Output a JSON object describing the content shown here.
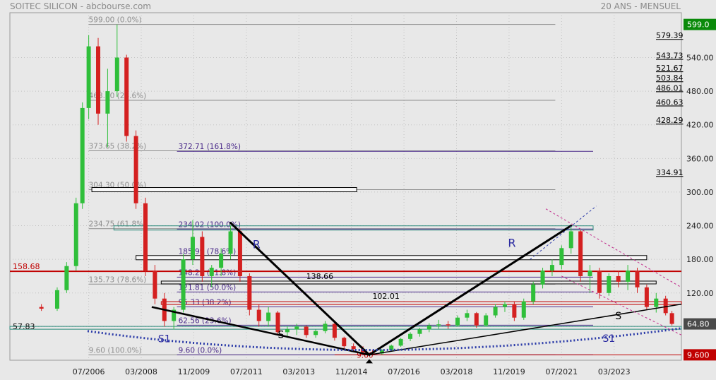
{
  "header": {
    "title": "SOITEC SILICON - abcbourse.com",
    "period": "20 ANS - MENSUEL"
  },
  "chart_data": {
    "type": "candlestick",
    "instrument": "SOITEC SILICON",
    "timeframe": "20 ANS - MENSUEL",
    "ylim": [
      0,
      620
    ],
    "x_range": [
      2004.0,
      2025.3
    ],
    "x_ticks": [
      "07/2006",
      "03/2008",
      "11/2009",
      "07/2011",
      "03/2013",
      "11/2014",
      "07/2016",
      "03/2018",
      "11/2019",
      "07/2021",
      "03/2023"
    ],
    "y_ticks": [
      60,
      120,
      180,
      240,
      300,
      360,
      420,
      480,
      540
    ],
    "y_tick_labels": [
      "",
      "120.00",
      "180.00",
      "240.00",
      "300.00",
      "360.00",
      "420.00",
      "480.00",
      "540.00"
    ],
    "right_labels": [
      "579.39",
      "543.73",
      "521.67",
      "503.84",
      "486.01",
      "460.63",
      "428.29",
      "334.91"
    ],
    "right_label_values": [
      579.39,
      543.73,
      521.67,
      503.84,
      486.01,
      460.63,
      428.29,
      334.91
    ],
    "price_badges": [
      {
        "label": "599.0",
        "value": 599.0,
        "color": "#0a8a0a"
      },
      {
        "label": "64.80",
        "value": 64.8,
        "color": "#4a4a4a"
      },
      {
        "label": "9.600",
        "value": 9.6,
        "color": "#c00000"
      }
    ],
    "fib_retracement_1": [
      {
        "label": "599.00  (0.0%)",
        "value": 599.0
      },
      {
        "label": "463.80  (23.6%)",
        "value": 463.8
      },
      {
        "label": "373.65  (38.2%)",
        "value": 373.65
      },
      {
        "label": "304.30  (50.0%)",
        "value": 304.3
      },
      {
        "label": "234.75  (61.8%)",
        "value": 234.75
      },
      {
        "label": "135.73  (78.6%)",
        "value": 135.73
      },
      {
        "label": "9.60  (100.0%)",
        "value": 9.6
      }
    ],
    "fib_retracement_2": [
      {
        "label": "372.71  (161.8%)",
        "value": 372.71
      },
      {
        "label": "234.02  (100.0%)",
        "value": 234.02
      },
      {
        "label": "185.99  (78.6%)",
        "value": 185.99
      },
      {
        "label": "148.29  (61.8%)",
        "value": 148.29
      },
      {
        "label": "121.81  (50.0%)",
        "value": 121.81
      },
      {
        "label": "95.33  (38.2%)",
        "value": 95.33
      },
      {
        "label": "62.56  (23.6%)",
        "value": 62.56
      },
      {
        "label": "9.60  (0.0%)",
        "value": 9.6
      }
    ],
    "horizontal_levels": [
      {
        "label": "158.68",
        "value": 158.68,
        "color": "#c00000"
      },
      {
        "label": "138.66",
        "value": 138.66,
        "color": "#000000"
      },
      {
        "label": "102.01",
        "value": 102.01,
        "color": "#000000"
      },
      {
        "label": "57.83",
        "value": 57.83,
        "color": "#2a8a7a"
      },
      {
        "label": "9.60",
        "value": 9.6,
        "color": "#c00000"
      }
    ],
    "annotations": [
      "R",
      "R",
      "S",
      "S",
      "S1",
      "S1"
    ],
    "candles": [
      {
        "t": 2005.0,
        "o": 95,
        "h": 100,
        "l": 88,
        "c": 92
      },
      {
        "t": 2005.5,
        "o": 92,
        "h": 130,
        "l": 88,
        "c": 125
      },
      {
        "t": 2005.8,
        "o": 125,
        "h": 175,
        "l": 120,
        "c": 168
      },
      {
        "t": 2006.1,
        "o": 168,
        "h": 290,
        "l": 160,
        "c": 280
      },
      {
        "t": 2006.3,
        "o": 280,
        "h": 460,
        "l": 270,
        "c": 450
      },
      {
        "t": 2006.5,
        "o": 450,
        "h": 580,
        "l": 430,
        "c": 560
      },
      {
        "t": 2006.8,
        "o": 560,
        "h": 575,
        "l": 420,
        "c": 440
      },
      {
        "t": 2007.1,
        "o": 440,
        "h": 520,
        "l": 380,
        "c": 480
      },
      {
        "t": 2007.4,
        "o": 480,
        "h": 599,
        "l": 470,
        "c": 540
      },
      {
        "t": 2007.7,
        "o": 540,
        "h": 545,
        "l": 390,
        "c": 400
      },
      {
        "t": 2008.0,
        "o": 400,
        "h": 410,
        "l": 270,
        "c": 280
      },
      {
        "t": 2008.3,
        "o": 280,
        "h": 290,
        "l": 150,
        "c": 160
      },
      {
        "t": 2008.6,
        "o": 160,
        "h": 170,
        "l": 100,
        "c": 110
      },
      {
        "t": 2008.9,
        "o": 110,
        "h": 120,
        "l": 60,
        "c": 70
      },
      {
        "t": 2009.2,
        "o": 70,
        "h": 95,
        "l": 55,
        "c": 90
      },
      {
        "t": 2009.5,
        "o": 90,
        "h": 190,
        "l": 85,
        "c": 180
      },
      {
        "t": 2009.8,
        "o": 180,
        "h": 250,
        "l": 170,
        "c": 220
      },
      {
        "t": 2010.1,
        "o": 220,
        "h": 230,
        "l": 140,
        "c": 150
      },
      {
        "t": 2010.4,
        "o": 150,
        "h": 170,
        "l": 130,
        "c": 165
      },
      {
        "t": 2010.7,
        "o": 165,
        "h": 200,
        "l": 150,
        "c": 190
      },
      {
        "t": 2011.0,
        "o": 190,
        "h": 240,
        "l": 180,
        "c": 230
      },
      {
        "t": 2011.3,
        "o": 230,
        "h": 235,
        "l": 140,
        "c": 150
      },
      {
        "t": 2011.6,
        "o": 150,
        "h": 155,
        "l": 80,
        "c": 90
      },
      {
        "t": 2011.9,
        "o": 90,
        "h": 100,
        "l": 60,
        "c": 70
      },
      {
        "t": 2012.2,
        "o": 70,
        "h": 95,
        "l": 60,
        "c": 85
      },
      {
        "t": 2012.5,
        "o": 85,
        "h": 88,
        "l": 45,
        "c": 50
      },
      {
        "t": 2012.8,
        "o": 50,
        "h": 60,
        "l": 40,
        "c": 55
      },
      {
        "t": 2013.1,
        "o": 55,
        "h": 65,
        "l": 45,
        "c": 60
      },
      {
        "t": 2013.4,
        "o": 60,
        "h": 62,
        "l": 40,
        "c": 45
      },
      {
        "t": 2013.7,
        "o": 45,
        "h": 55,
        "l": 40,
        "c": 52
      },
      {
        "t": 2014.0,
        "o": 52,
        "h": 70,
        "l": 48,
        "c": 65
      },
      {
        "t": 2014.3,
        "o": 65,
        "h": 68,
        "l": 35,
        "c": 40
      },
      {
        "t": 2014.6,
        "o": 40,
        "h": 42,
        "l": 20,
        "c": 25
      },
      {
        "t": 2014.9,
        "o": 25,
        "h": 30,
        "l": 15,
        "c": 20
      },
      {
        "t": 2015.2,
        "o": 20,
        "h": 25,
        "l": 12,
        "c": 14
      },
      {
        "t": 2015.5,
        "o": 14,
        "h": 18,
        "l": 9.6,
        "c": 12
      },
      {
        "t": 2015.8,
        "o": 12,
        "h": 20,
        "l": 10,
        "c": 18
      },
      {
        "t": 2016.1,
        "o": 18,
        "h": 28,
        "l": 16,
        "c": 26
      },
      {
        "t": 2016.4,
        "o": 26,
        "h": 40,
        "l": 24,
        "c": 38
      },
      {
        "t": 2016.7,
        "o": 38,
        "h": 50,
        "l": 34,
        "c": 47
      },
      {
        "t": 2017.0,
        "o": 47,
        "h": 58,
        "l": 42,
        "c": 55
      },
      {
        "t": 2017.3,
        "o": 55,
        "h": 66,
        "l": 50,
        "c": 62
      },
      {
        "t": 2017.6,
        "o": 62,
        "h": 72,
        "l": 56,
        "c": 64
      },
      {
        "t": 2017.9,
        "o": 64,
        "h": 70,
        "l": 56,
        "c": 62
      },
      {
        "t": 2018.2,
        "o": 62,
        "h": 80,
        "l": 60,
        "c": 76
      },
      {
        "t": 2018.5,
        "o": 76,
        "h": 90,
        "l": 70,
        "c": 84
      },
      {
        "t": 2018.8,
        "o": 84,
        "h": 86,
        "l": 58,
        "c": 62
      },
      {
        "t": 2019.1,
        "o": 62,
        "h": 84,
        "l": 60,
        "c": 80
      },
      {
        "t": 2019.4,
        "o": 80,
        "h": 100,
        "l": 76,
        "c": 95
      },
      {
        "t": 2019.7,
        "o": 95,
        "h": 105,
        "l": 86,
        "c": 100
      },
      {
        "t": 2020.0,
        "o": 100,
        "h": 104,
        "l": 70,
        "c": 76
      },
      {
        "t": 2020.3,
        "o": 76,
        "h": 110,
        "l": 72,
        "c": 105
      },
      {
        "t": 2020.6,
        "o": 105,
        "h": 140,
        "l": 100,
        "c": 135
      },
      {
        "t": 2020.9,
        "o": 135,
        "h": 165,
        "l": 128,
        "c": 160
      },
      {
        "t": 2021.2,
        "o": 160,
        "h": 180,
        "l": 150,
        "c": 170
      },
      {
        "t": 2021.5,
        "o": 170,
        "h": 205,
        "l": 162,
        "c": 200
      },
      {
        "t": 2021.8,
        "o": 200,
        "h": 240,
        "l": 190,
        "c": 230
      },
      {
        "t": 2022.1,
        "o": 230,
        "h": 232,
        "l": 140,
        "c": 150
      },
      {
        "t": 2022.4,
        "o": 150,
        "h": 170,
        "l": 120,
        "c": 160
      },
      {
        "t": 2022.7,
        "o": 160,
        "h": 165,
        "l": 110,
        "c": 120
      },
      {
        "t": 2023.0,
        "o": 120,
        "h": 155,
        "l": 115,
        "c": 150
      },
      {
        "t": 2023.3,
        "o": 150,
        "h": 160,
        "l": 130,
        "c": 140
      },
      {
        "t": 2023.6,
        "o": 140,
        "h": 170,
        "l": 125,
        "c": 160
      },
      {
        "t": 2023.9,
        "o": 160,
        "h": 165,
        "l": 120,
        "c": 130
      },
      {
        "t": 2024.2,
        "o": 130,
        "h": 135,
        "l": 90,
        "c": 95
      },
      {
        "t": 2024.5,
        "o": 95,
        "h": 120,
        "l": 85,
        "c": 110
      },
      {
        "t": 2024.8,
        "o": 110,
        "h": 115,
        "l": 80,
        "c": 84
      },
      {
        "t": 2025.0,
        "o": 84,
        "h": 88,
        "l": 62,
        "c": 64.8
      }
    ]
  }
}
